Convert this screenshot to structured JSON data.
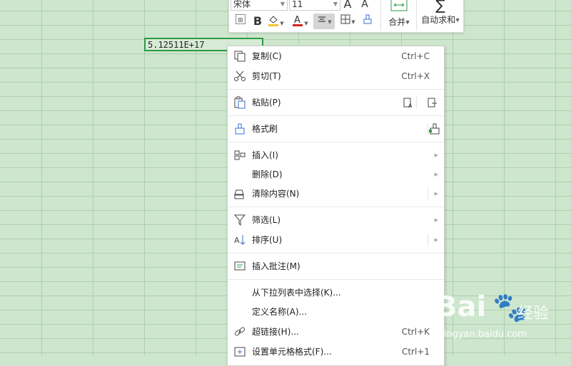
{
  "cell": {
    "value": "5.12511E+17"
  },
  "toolbar": {
    "font_name": "宋体",
    "font_size": "11",
    "merge_label": "合并",
    "autosum_label": "自动求和",
    "fill_color": "#f2c42f",
    "font_color": "#d22222"
  },
  "menu": {
    "copy": {
      "label": "复制(C)",
      "shortcut": "Ctrl+C"
    },
    "cut": {
      "label": "剪切(T)",
      "shortcut": "Ctrl+X"
    },
    "paste": {
      "label": "粘贴(P)"
    },
    "format_painter": {
      "label": "格式刷"
    },
    "insert": {
      "label": "插入(I)"
    },
    "delete": {
      "label": "删除(D)"
    },
    "clear": {
      "label": "清除内容(N)"
    },
    "filter": {
      "label": "筛选(L)"
    },
    "sort": {
      "label": "排序(U)"
    },
    "insert_comment": {
      "label": "插入批注(M)"
    },
    "pick_from_list": {
      "label": "从下拉列表中选择(K)..."
    },
    "define_name": {
      "label": "定义名称(A)..."
    },
    "hyperlink": {
      "label": "超链接(H)...",
      "shortcut": "Ctrl+K"
    },
    "format_cells": {
      "label": "设置单元格格式(F)...",
      "shortcut": "Ctrl+1"
    }
  },
  "watermark": {
    "brand": "Bai",
    "brand2": "经验",
    "url": "jingyan.baidu.com"
  }
}
